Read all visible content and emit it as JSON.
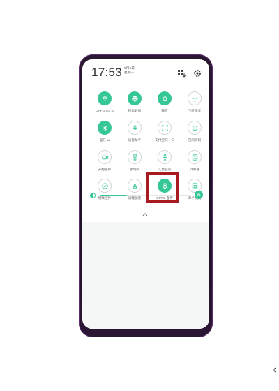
{
  "status": {
    "time": "17:53",
    "date_line1": "5月6日",
    "date_line2": "星期三"
  },
  "tiles": [
    {
      "label": "OPPO 5G ⊿",
      "icon": "wifi-icon",
      "active": true
    },
    {
      "label": "移动数据",
      "icon": "globe-icon",
      "active": true
    },
    {
      "label": "静音",
      "icon": "bell-icon",
      "active": true
    },
    {
      "label": "飞行模式",
      "icon": "airplane-icon",
      "active": false
    },
    {
      "label": "蓝牙 ⊿",
      "icon": "bluetooth-icon",
      "active": true
    },
    {
      "label": "语音助手",
      "icon": "microphone-icon",
      "active": false
    },
    {
      "label": "支付宝扫一扫",
      "icon": "scan-icon",
      "active": false
    },
    {
      "label": "夜间护眼",
      "icon": "eye-care-icon",
      "active": false
    },
    {
      "label": "开始录屏",
      "icon": "screen-record-icon",
      "active": false
    },
    {
      "label": "手电筒",
      "icon": "flashlight-icon",
      "active": false
    },
    {
      "label": "儿童空间",
      "icon": "kids-space-icon",
      "active": false
    },
    {
      "label": "计算器",
      "icon": "calculator-icon",
      "active": false
    },
    {
      "label": "物联控件",
      "icon": "iot-icon",
      "active": false
    },
    {
      "label": "清理加速",
      "icon": "cleanup-icon",
      "active": false
    },
    {
      "label": "OPPO 互传",
      "icon": "oppo-share-icon",
      "active": true
    },
    {
      "label": "单手模式",
      "icon": "one-hand-icon",
      "active": false
    }
  ],
  "brightness": {
    "auto_label": "A",
    "level": 0.3
  },
  "colors": {
    "accent": "#35c796",
    "highlight": "#a81a1f"
  }
}
